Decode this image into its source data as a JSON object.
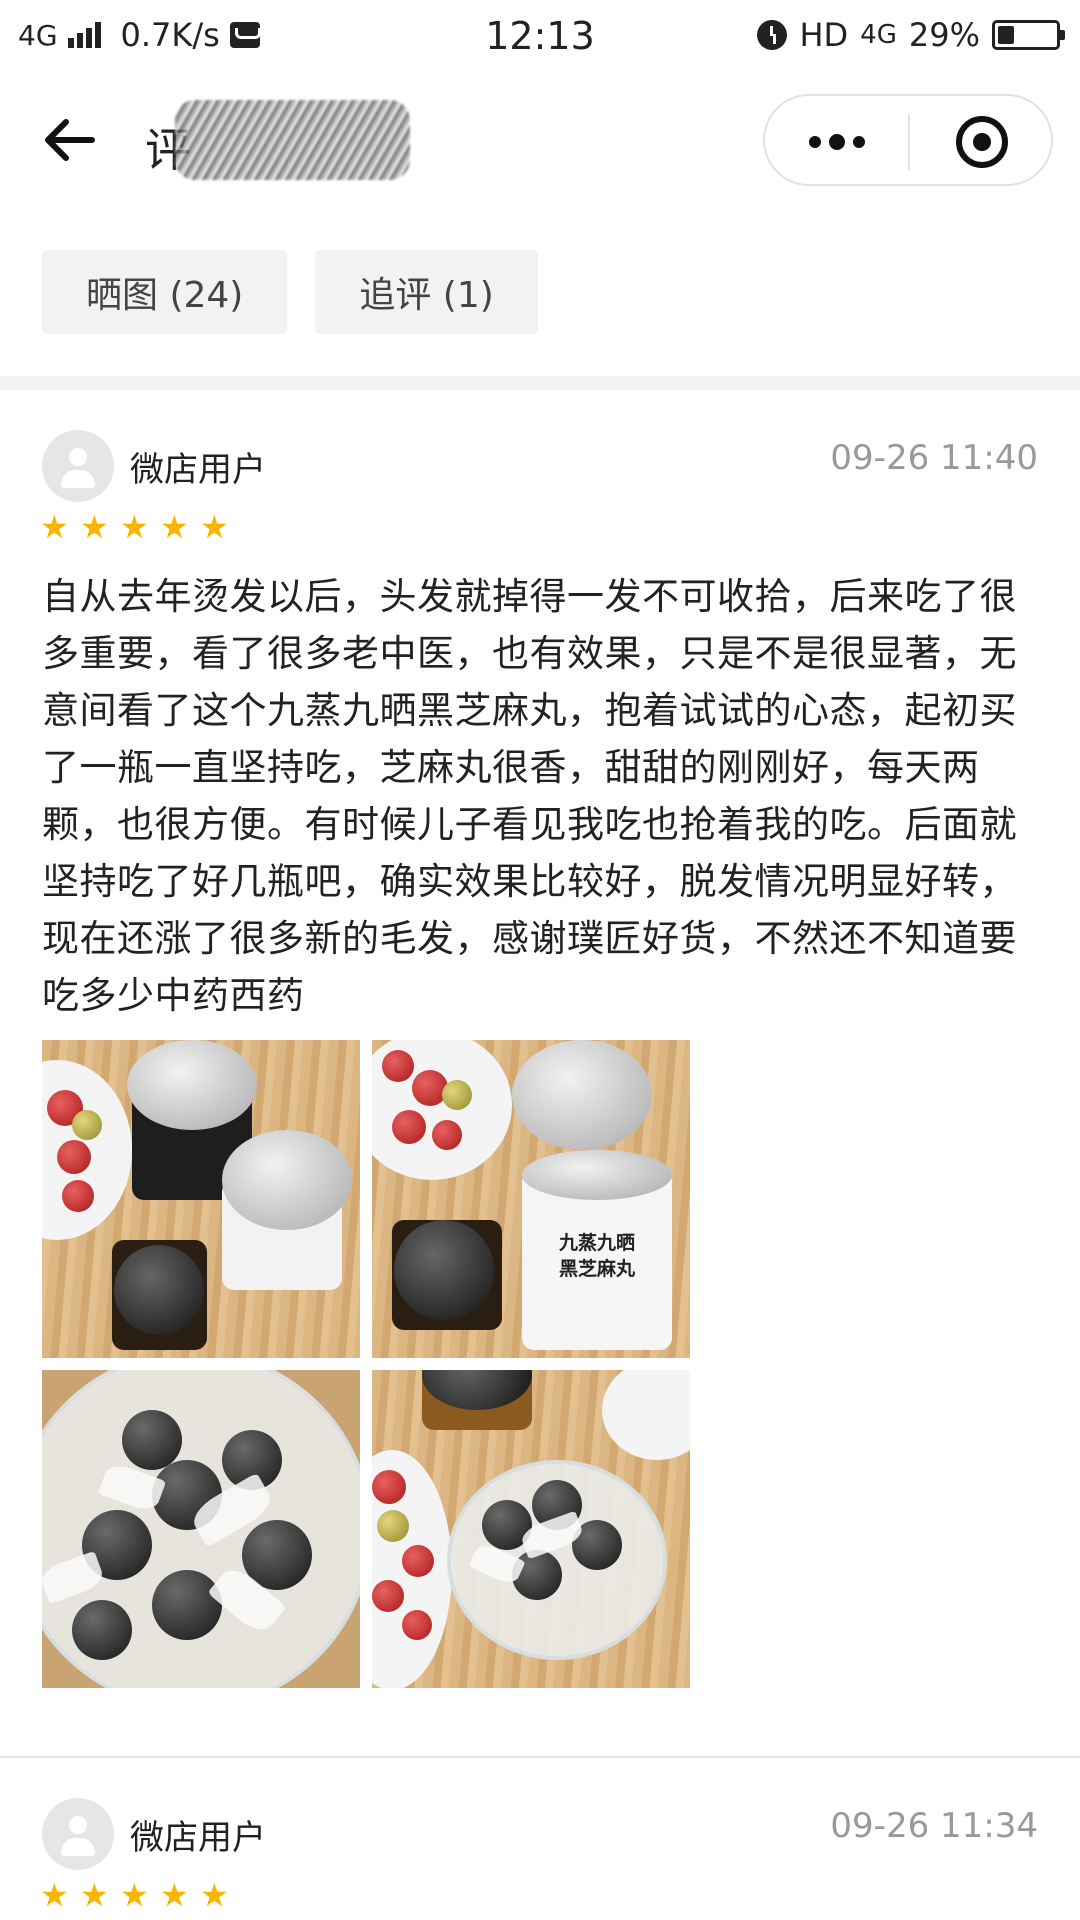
{
  "status_bar": {
    "network": "4G",
    "speed": "0.7K/s",
    "time": "12:13",
    "hd": "HD",
    "net_right": "4G",
    "battery_percent": "29%",
    "battery_level": 0.29
  },
  "nav": {
    "title_visible": "评",
    "more_icon": "more-dots-icon",
    "close_icon": "target-circle-icon"
  },
  "filters": [
    {
      "label": "晒图 (24)"
    },
    {
      "label": "追评 (1)"
    }
  ],
  "reviews": [
    {
      "user": "微店用户",
      "time": "09-26 11:40",
      "rating": 5,
      "text": "自从去年烫发以后，头发就掉得一发不可收拾，后来吃了很多重要，看了很多老中医，也有效果，只是不是很显著，无意间看了这个九蒸九晒黑芝麻丸，抱着试试的心态，起初买了一瓶一直坚持吃，芝麻丸很香，甜甜的刚刚好，每天两颗，也很方便。有时候儿子看见我吃也抢着我的吃。后面就坚持吃了好几瓶吧，确实效果比较好，脱发情况明显好转，现在还涨了很多新的毛发，感谢璞匠好货，不然还不知道要吃多少中药西药",
      "photo_label_line1": "九蒸九晒",
      "photo_label_line2": "黑芝麻丸"
    },
    {
      "user": "微店用户",
      "time": "09-26 11:34",
      "rating": 5
    }
  ],
  "star_glyph": "★"
}
